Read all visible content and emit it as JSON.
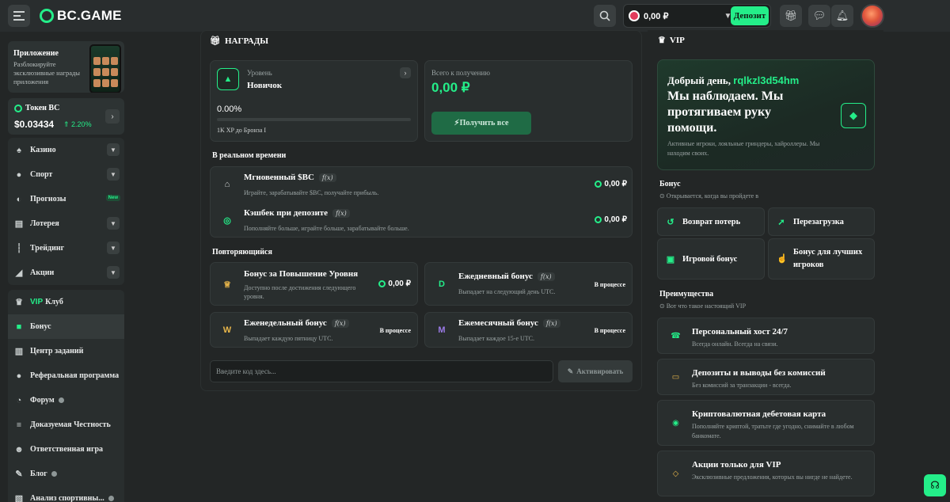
{
  "header": {
    "logo_text": "BC.GAME",
    "balance": "0,00 ₽",
    "deposit_label": "Депозит"
  },
  "sidebar": {
    "promo": {
      "title": "Приложение",
      "subtitle": "Разблокируйте эксклюзивные награды приложения"
    },
    "token": {
      "name": "Токен BC",
      "price": "$0.03434",
      "change": "2.20%"
    },
    "group1": [
      {
        "label": "Казино",
        "icon": "cards-icon"
      },
      {
        "label": "Спорт",
        "icon": "ball-icon"
      },
      {
        "label": "Прогнозы",
        "icon": "forecast-icon",
        "badge": "New"
      },
      {
        "label": "Лотерея",
        "icon": "ticket-icon"
      },
      {
        "label": "Трейдинг",
        "icon": "chart-icon"
      },
      {
        "label": "Акции",
        "icon": "megaphone-icon"
      }
    ],
    "group2": [
      {
        "vip": "VIP",
        "label": "Клуб"
      },
      {
        "label": "Бонус"
      },
      {
        "label": "Центр заданий"
      },
      {
        "label": "Реферальная программа"
      },
      {
        "label": "Форум"
      },
      {
        "label": "Доказуемая Честность"
      },
      {
        "label": "Ответственная игра"
      },
      {
        "label": "Блог"
      },
      {
        "label": "Анализ спортивны..."
      }
    ]
  },
  "rewards": {
    "title": "НАГРАДЫ",
    "level_label": "Уровень",
    "level_name": "Новичок",
    "progress_pct": "0.00%",
    "progress_fraction": 0,
    "xp_note": "1K XP до Бронза I",
    "total_label": "Всего к получению",
    "total_value": "0,00 ₽",
    "claim_label": "Получить все",
    "realtime_title": "В реальном времени",
    "realtime": [
      {
        "title": "Мгновенный $BC",
        "fx": "f(x)",
        "sub": "Играйте, зарабатывайте $BC, получайте прибыль.",
        "amount": "0,00 ₽"
      },
      {
        "title": "Кэшбек при депозите",
        "fx": "f(x)",
        "sub": "Пополняйте больше, играйте больше, зарабатывайте больше.",
        "amount": "0,00 ₽"
      }
    ],
    "recurring_title": "Повторяющийся",
    "recurring": [
      {
        "title": "Бонус за Повышение Уровня",
        "sub": "Доступно после достижения следующего уровня.",
        "amount": "0,00 ₽"
      },
      {
        "title": "Ежедневный бонус",
        "fx": "f(x)",
        "sub": "Выпадает на следующий день UTC.",
        "status": "В процессе",
        "letter": "D"
      },
      {
        "title": "Еженедельный бонус",
        "fx": "f(x)",
        "sub": "Выпадает каждую пятницу UTC.",
        "status": "В процессе",
        "letter": "W"
      },
      {
        "title": "Ежемесячный бонус",
        "fx": "f(x)",
        "sub": "Выпадает каждое 15-е UTC.",
        "status": "В процессе",
        "letter": "M"
      }
    ],
    "code_placeholder": "Введите код здесь...",
    "activate_label": "Активировать"
  },
  "vip": {
    "title": "VIP",
    "greeting": "Добрый день,",
    "username": "rqlkzl3d54hm",
    "headline": "Мы наблюдаем. Мы протягиваем руку помощи.",
    "desc": "Активные игроки, лояльные гриндеры, хайроллеры. Мы находим своих.",
    "bonus_title": "Бонус",
    "bonus_sub": "Открывается, когда вы пройдете в",
    "bonus_tiles": [
      "Возврат потерь",
      "Перезагрузка",
      "Игровой бонус",
      "Бонус для лучших игроков"
    ],
    "perks_title": "Преимущества",
    "perks_sub": "Вот что такое настоящий VIP",
    "perks": [
      {
        "title": "Персональный хост 24/7",
        "sub": "Всегда онлайн. Всегда на связи."
      },
      {
        "title": "Депозиты и выводы без комиссий",
        "sub": "Без комиссий за транзакции - всегда."
      },
      {
        "title": "Криптовалютная дебетовая карта",
        "sub": "Пополняйте криптой, тратьте где угодно, снимайте в любом банкомате."
      },
      {
        "title": "Акции только для VIP",
        "sub": "Эксклюзивные предложения, которых вы нигде не найдете."
      }
    ]
  }
}
